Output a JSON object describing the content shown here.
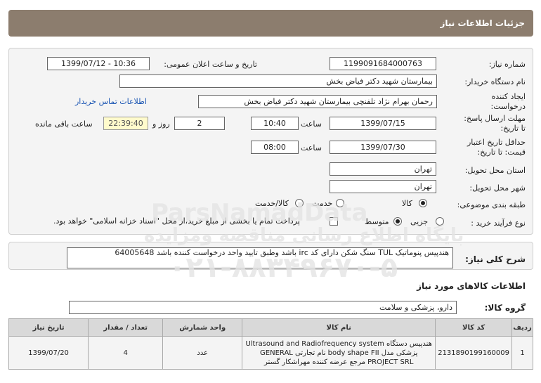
{
  "header": {
    "title": "جزئیات اطلاعات نیاز"
  },
  "form": {
    "need_number_label": "شماره نیاز:",
    "need_number": "1199091684000763",
    "announce_label": "تاریخ و ساعت اعلان عمومی:",
    "announce_value": "1399/07/12 - 10:36",
    "buyer_org_label": "نام دستگاه خریدار:",
    "buyer_org": "بیمارستان شهید دکتر فیاض بخش",
    "requester_label": "ایجاد کننده درخواست:",
    "requester": "رحمان بهرام نژاد تلفنچی بیمارستان شهید دکتر فیاض بخش",
    "contact_link": "اطلاعات تماس خریدار",
    "reply_deadline_label": "مهلت ارسال پاسخ: تا تاریخ:",
    "reply_date": "1399/07/15",
    "time_label": "ساعت",
    "reply_time": "10:40",
    "days_value": "2",
    "days_label": "روز و",
    "remaining_time": "22:39:40",
    "remaining_label": "ساعت باقی مانده",
    "validity_label": "حداقل تاریخ اعتبار قیمت: تا تاریخ:",
    "validity_date": "1399/07/30",
    "validity_time": "08:00",
    "province_label": "استان محل تحویل:",
    "province": "تهران",
    "city_label": "شهر محل تحویل:",
    "city": "تهران",
    "category_label": "طبقه بندی موضوعی:",
    "category_options": [
      "کالا",
      "خدمت",
      "کالا/خدمت"
    ],
    "process_label": "نوع فرآیند خرید :",
    "process_options": [
      "جزیی",
      "متوسط"
    ],
    "payment_note": "پرداخت تمام یا بخشی از مبلغ خرید،از محل \"اسناد خزانه اسلامی\" خواهد بود."
  },
  "description": {
    "label": "شرح کلی نیاز:",
    "text": "هندپیس پنوماتیک TUL سنگ شکن دارای کد irc باشد وطبق تایید واحد درخواست کننده باشد 64005648"
  },
  "goods": {
    "section_title": "اطلاعات کالاهای مورد نیاز",
    "group_label": "گروه کالا:",
    "group_value": "دارو، پزشکی و سلامت",
    "columns": [
      "ردیف",
      "کد کالا",
      "نام کالا",
      "واحد شمارش",
      "تعداد / مقدار",
      "تاریخ نیاز"
    ],
    "rows": [
      {
        "row": "1",
        "code": "2131890199160009",
        "name_line1": "هندپیس دستگاه Ultrasound and Radiofrequency system",
        "name_line2": "پزشکی مدل body shape FII نام تجارتی GENERAL",
        "name_line3": "PROJECT SRL مرجع عرضه کننده مهراشکار گستر",
        "unit": "عدد",
        "qty": "4",
        "date": "1399/07/20"
      }
    ]
  },
  "watermark": {
    "line1": "ParsNamadData",
    "line2": "پایگاه اطلاع رسانی مناقصه ومزایده",
    "line3": "۰۲۱-۸۸۳۴۹۶۷۰-۵"
  }
}
